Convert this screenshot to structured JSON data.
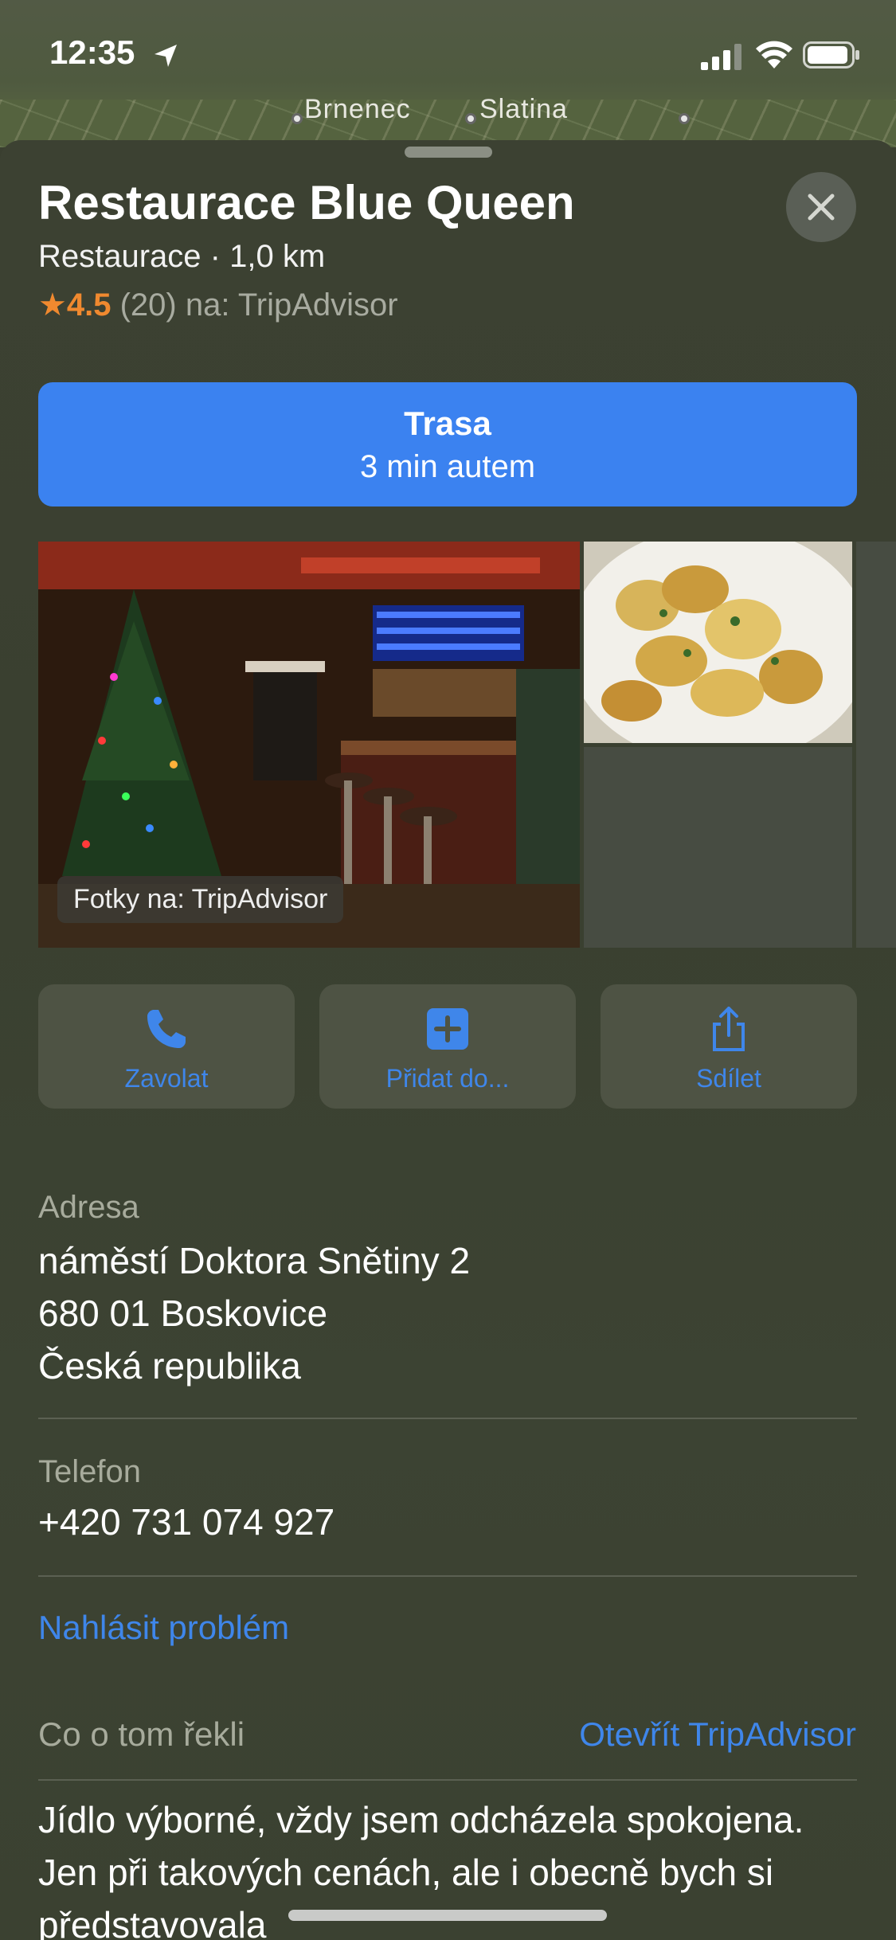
{
  "status_bar": {
    "time": "12:35"
  },
  "map": {
    "labels": [
      "Brnenec",
      "Slatina"
    ]
  },
  "place": {
    "name": "Restaurace Blue Queen",
    "subtitle": "Restaurace · 1,0 km",
    "rating_star": "★",
    "rating": "4.5",
    "rating_meta": "(20) na: TripAdvisor"
  },
  "route": {
    "title": "Trasa",
    "subtitle": "3 min autem"
  },
  "photos": {
    "caption": "Fotky na: TripAdvisor"
  },
  "actions": [
    {
      "label": "Zavolat",
      "icon": "phone-icon"
    },
    {
      "label": "Přidat do...",
      "icon": "plus-square-icon"
    },
    {
      "label": "Sdílet",
      "icon": "share-icon"
    }
  ],
  "address": {
    "label": "Adresa",
    "line1": "náměstí Doktora Snětiny 2",
    "line2": "680 01 Boskovice",
    "line3": "Česká republika"
  },
  "phone": {
    "label": "Telefon",
    "value": "+420 731 074 927"
  },
  "report_problem": "Nahlásit problém",
  "reviews": {
    "header": "Co o tom řekli",
    "open_link": "Otevřít TripAdvisor",
    "text": "Jídlo výborné, vždy jsem odcházela spokojena. Jen při takových cenách, ale i obecně bych si představovala"
  },
  "colors": {
    "accent": "#3b82f0",
    "star": "#f0892f",
    "card": "#3c4132"
  }
}
